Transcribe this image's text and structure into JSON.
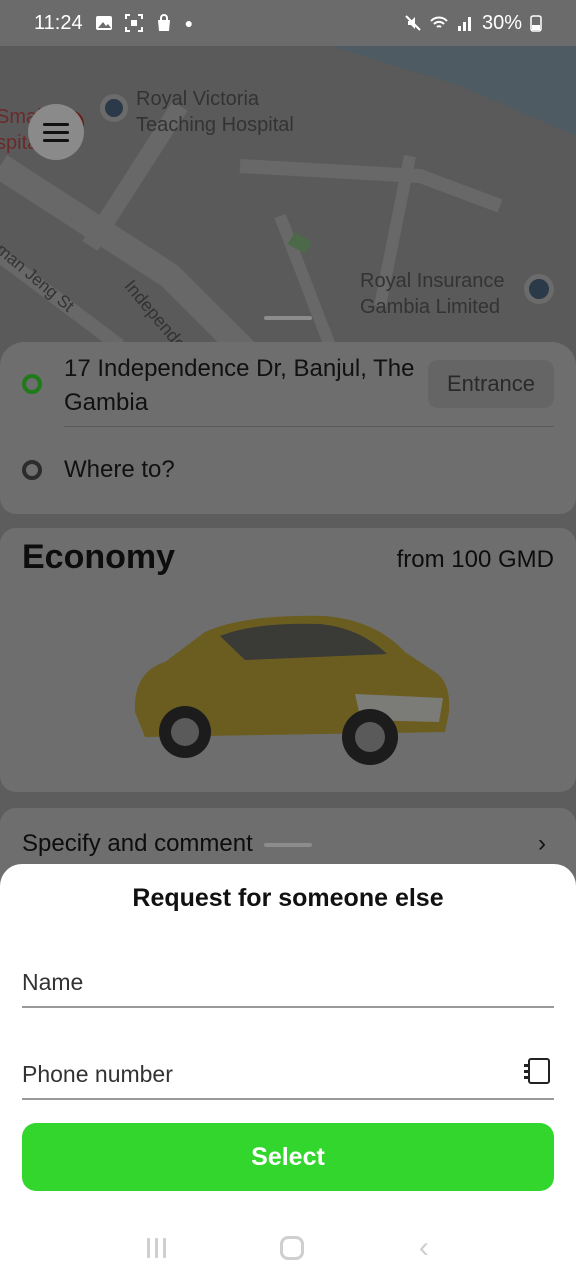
{
  "status_bar": {
    "time": "11:24",
    "battery": "30%"
  },
  "map": {
    "labels": [
      "Royal Victoria",
      "Teaching Hospital",
      "Royal Insurance",
      "Gambia Limited",
      "Independence",
      "sman Jeng St",
      "Small",
      "spital"
    ]
  },
  "route": {
    "pickup": "17 Independence Dr, Banjul, The Gambia",
    "entrance_label": "Entrance",
    "destination_placeholder": "Where to?"
  },
  "tariff": {
    "name": "Economy",
    "price": "from 100 GMD"
  },
  "options": {
    "label": "Specify and comment",
    "chevron": "›"
  },
  "sheet": {
    "title": "Request for someone else",
    "name_placeholder": "Name",
    "phone_placeholder": "Phone number",
    "select_label": "Select"
  },
  "colors": {
    "accent_green": "#33d62d",
    "scrim": "#5d5d5d"
  },
  "icons": [
    "menu-icon",
    "hospital-icon",
    "place-pin-icon",
    "contact-book-icon",
    "chevron-right-icon",
    "nav-recent-icon",
    "nav-home-icon",
    "nav-back-icon"
  ]
}
